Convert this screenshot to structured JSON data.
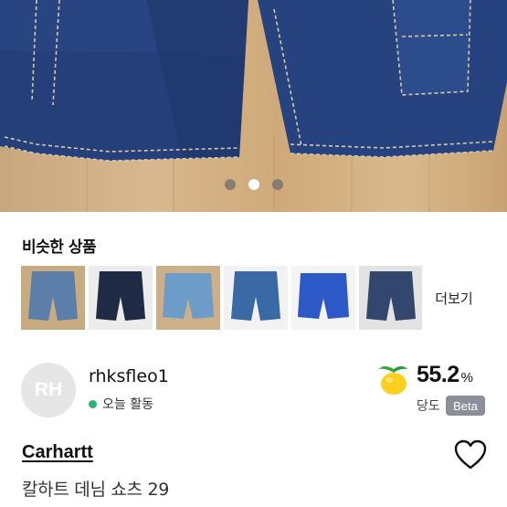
{
  "gallery": {
    "dot_count": 3,
    "active_index": 1
  },
  "similar": {
    "title": "비슷한 상품",
    "more_label": "더보기",
    "thumbs": [
      {
        "name": "light-wash-denim-shorts",
        "color": "#5b7fa8"
      },
      {
        "name": "dark-navy-denim-shorts",
        "color": "#1f2a44"
      },
      {
        "name": "light-blue-denim-shorts",
        "color": "#6d9cc9"
      },
      {
        "name": "medium-blue-denim-shorts",
        "color": "#3a6aa6"
      },
      {
        "name": "bright-blue-shorts",
        "color": "#2c58c8"
      },
      {
        "name": "carpenter-denim-shorts",
        "color": "#33476e"
      }
    ]
  },
  "seller": {
    "initials": "RH",
    "name": "rhksfleo1",
    "activity": "오늘 활동",
    "sweetness_value": "55.2",
    "sweetness_unit": "%",
    "sweetness_label": "당도",
    "beta_label": "Beta"
  },
  "product": {
    "brand": "Carhartt",
    "title": "칼하트 데님 쇼츠 29"
  },
  "colors": {
    "active_green": "#2bb673",
    "beta_gray": "#8a8f99"
  }
}
